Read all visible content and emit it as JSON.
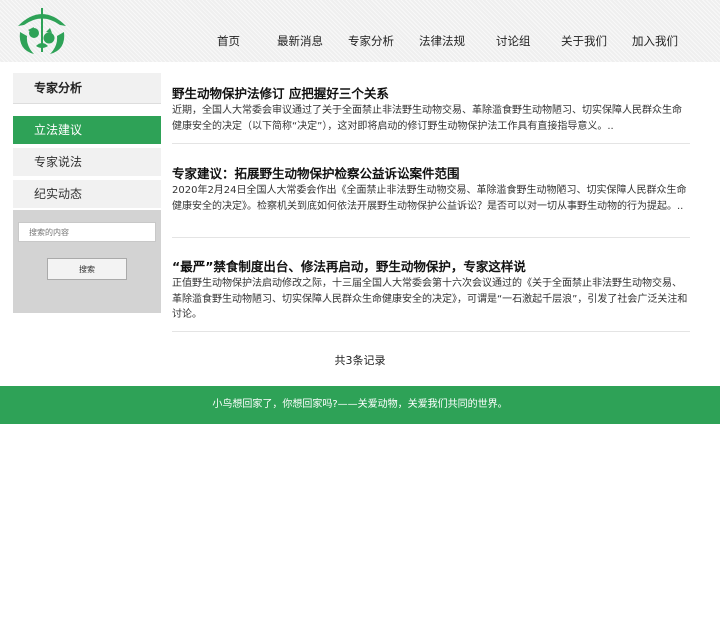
{
  "nav": {
    "items": [
      "首页",
      "最新消息",
      "专家分析",
      "法律法规",
      "讨论组",
      "关于我们",
      "加入我们"
    ]
  },
  "sidebar": {
    "heading": "专家分析",
    "items": [
      {
        "label": "立法建议",
        "active": true
      },
      {
        "label": "专家说法",
        "active": false
      },
      {
        "label": "纪实动态",
        "active": false
      }
    ],
    "search": {
      "placeholder": "搜索的内容",
      "button_label": "搜索"
    }
  },
  "articles": [
    {
      "title": "野生动物保护法修订 应把握好三个关系",
      "summary": "近期，全国人大常委会审议通过了关于全面禁止非法野生动物交易、革除滥食野生动物陋习、切实保障人民群众生命健康安全的决定（以下简称“决定”），这对即将启动的修订野生动物保护法工作具有直接指导意义。.."
    },
    {
      "title": "专家建议：拓展野生动物保护检察公益诉讼案件范围",
      "summary": "2020年2月24日全国人大常委会作出《全面禁止非法野生动物交易、革除滥食野生动物陋习、切实保障人民群众生命健康安全的决定》。检察机关到底如何依法开展野生动物保护公益诉讼？是否可以对一切从事野生动物的行为提起。.."
    },
    {
      "title": "“最严”禁食制度出台、修法再启动，野生动物保护，专家这样说",
      "summary": "正值野生动物保护法启动修改之际，十三届全国人大常委会第十六次会议通过的《关于全面禁止非法野生动物交易、革除滥食野生动物陋习、切实保障人民群众生命健康安全的决定》，可谓是“一石激起千层浪”，引发了社会广泛关注和讨论。"
    }
  ],
  "records_text": "共3条记录",
  "footer_text": "小鸟想回家了，你想回家吗?——关爱动物，关爱我们共同的世界。",
  "colors": {
    "accent": "#2ea257"
  },
  "icons": {
    "logo": "wildlife-protection-logo-icon"
  }
}
